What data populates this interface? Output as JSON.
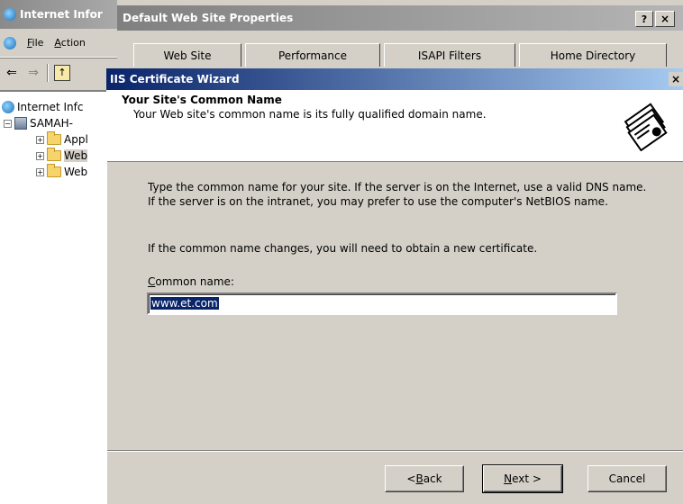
{
  "mmc": {
    "title": "Internet Infor",
    "menu": [
      {
        "accel": "F",
        "rest": "ile"
      },
      {
        "accel": "A",
        "rest": "ction"
      }
    ],
    "tree": [
      {
        "label": "Internet Infc",
        "level": 0
      },
      {
        "label": "SAMAH-",
        "level": 1
      },
      {
        "label": "Appl",
        "level": 2
      },
      {
        "label": "Web",
        "level": 2
      },
      {
        "label": "Web",
        "level": 2
      }
    ]
  },
  "properties": {
    "title": "Default Web Site Properties",
    "help_button": "?",
    "close_button": "×",
    "tabs": [
      "Web Site",
      "Performance",
      "ISAPI Filters",
      "Home Directory"
    ]
  },
  "wizard": {
    "title": "IIS Certificate Wizard",
    "close_button": "×",
    "header_title": "Your Site's Common Name",
    "header_subtitle": "Your Web site's common name is its fully qualified domain name.",
    "para1": "Type the common name for your site. If the server is on the Internet, use a valid DNS name. If the server is on the intranet, you may prefer to use the computer's NetBIOS name.",
    "para2": "If the common name changes, you will need to obtain a new certificate.",
    "field_label_accel": "C",
    "field_label_rest": "ommon name:",
    "field_value": "www.et.com",
    "buttons": {
      "back_arrow": "< ",
      "back_accel": "B",
      "back_rest": "ack",
      "next_accel": "N",
      "next_rest": "ext >",
      "cancel": "Cancel"
    }
  }
}
